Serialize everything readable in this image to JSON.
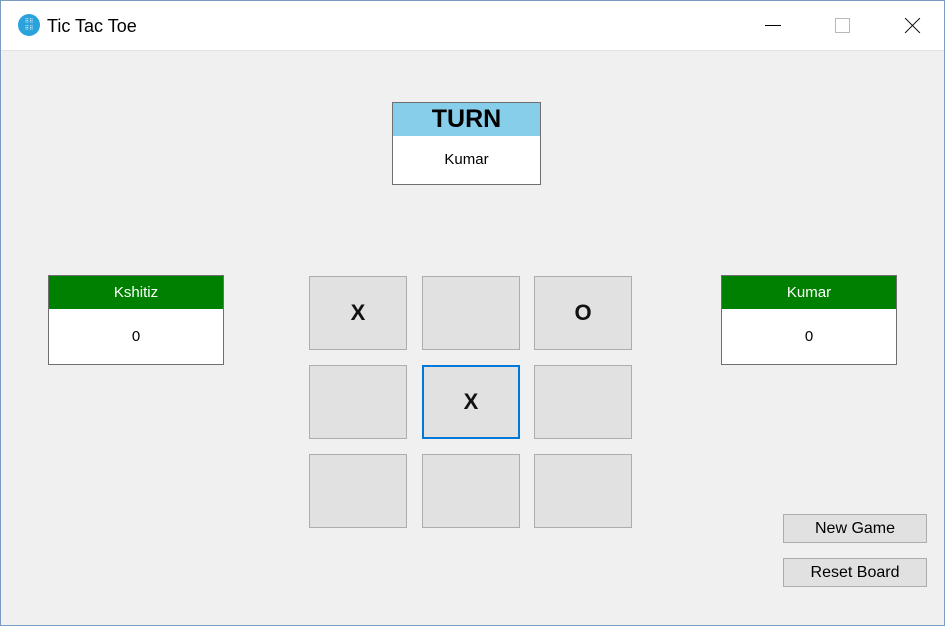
{
  "window": {
    "title": "Tic Tac Toe",
    "icon": "grid-dots-icon",
    "controls": [
      "minimize-icon",
      "maximize-icon",
      "close-icon"
    ]
  },
  "turn": {
    "header": "TURN",
    "player": "Kumar",
    "header_color": "#87ceeb"
  },
  "players": {
    "left": {
      "name": "Kshitiz",
      "score": "0"
    },
    "right": {
      "name": "Kumar",
      "score": "0"
    },
    "header_color": "#008000"
  },
  "board": {
    "cells": [
      "X",
      "",
      "O",
      "",
      "X",
      "",
      "",
      "",
      ""
    ],
    "focused_cell": 4,
    "focus_color": "#0078d7"
  },
  "actions": {
    "new_game": "New Game",
    "reset_board": "Reset Board"
  }
}
